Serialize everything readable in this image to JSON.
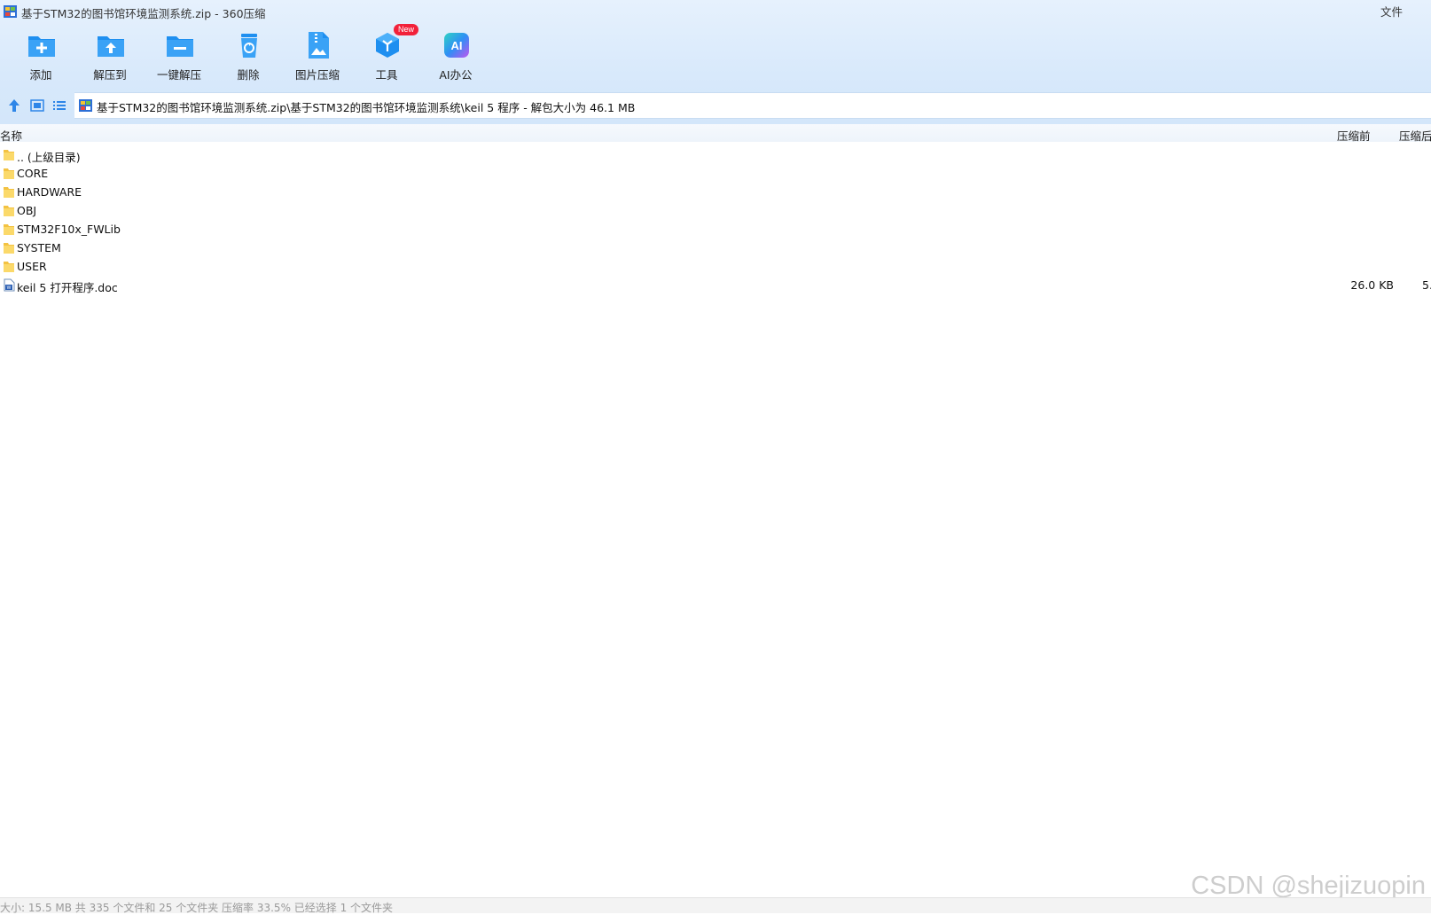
{
  "window": {
    "title": "基于STM32的图书馆环境监测系统.zip - 360压缩",
    "menu_file": "文件"
  },
  "toolbar": {
    "items": [
      {
        "label": "添加",
        "icon": "add-folder-icon"
      },
      {
        "label": "解压到",
        "icon": "extract-to-icon"
      },
      {
        "label": "一键解压",
        "icon": "one-click-extract-icon"
      },
      {
        "label": "删除",
        "icon": "recycle-bin-icon"
      },
      {
        "label": "图片压缩",
        "icon": "image-compress-icon"
      },
      {
        "label": "工具",
        "icon": "tools-cube-icon",
        "badge": "New"
      },
      {
        "label": "AI办公",
        "icon": "ai-office-icon"
      }
    ]
  },
  "address": {
    "path": "基于STM32的图书馆环境监测系统.zip\\基于STM32的图书馆环境监测系统\\keil 5 程序 - 解包大小为 46.1 MB"
  },
  "columns": {
    "name": "名称",
    "size_before": "压缩前",
    "size_after": "压缩后"
  },
  "files": [
    {
      "name": ".. (上级目录)",
      "type": "folder",
      "size": "",
      "compressed": ""
    },
    {
      "name": "CORE",
      "type": "folder",
      "size": "",
      "compressed": ""
    },
    {
      "name": "HARDWARE",
      "type": "folder",
      "size": "",
      "compressed": ""
    },
    {
      "name": "OBJ",
      "type": "folder",
      "size": "",
      "compressed": ""
    },
    {
      "name": "STM32F10x_FWLib",
      "type": "folder",
      "size": "",
      "compressed": ""
    },
    {
      "name": "SYSTEM",
      "type": "folder",
      "size": "",
      "compressed": ""
    },
    {
      "name": "USER",
      "type": "folder",
      "size": "",
      "compressed": ""
    },
    {
      "name": "keil 5 打开程序.doc",
      "type": "doc",
      "size": "26.0 KB",
      "compressed": "5."
    }
  ],
  "status": {
    "text": "大小: 15.5 MB 共 335 个文件和 25 个文件夹 压缩率 33.5% 已经选择 1 个文件夹"
  },
  "watermark": "CSDN @shejizuopin",
  "colors": {
    "accent": "#1e8ff0",
    "folder": "#f7c948",
    "badge": "#f2213a"
  }
}
